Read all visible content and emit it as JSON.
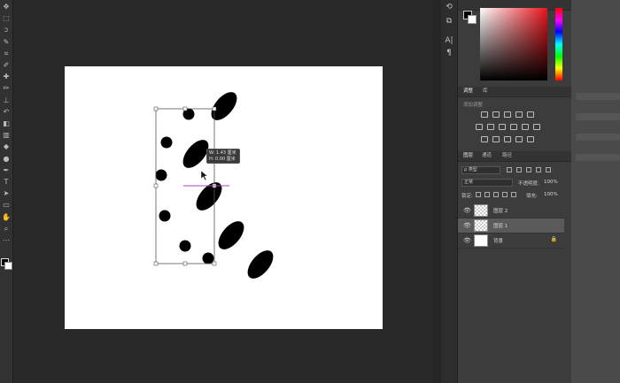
{
  "toolbar": {
    "tools": [
      {
        "name": "move-tool-icon",
        "glyph": "✥"
      },
      {
        "name": "marquee-tool-icon",
        "glyph": "⬚"
      },
      {
        "name": "lasso-tool-icon",
        "glyph": "ↄ"
      },
      {
        "name": "quick-select-tool-icon",
        "glyph": "✎"
      },
      {
        "name": "crop-tool-icon",
        "glyph": "⌗"
      },
      {
        "name": "eyedropper-tool-icon",
        "glyph": "✐"
      },
      {
        "name": "healing-brush-tool-icon",
        "glyph": "✚"
      },
      {
        "name": "brush-tool-icon",
        "glyph": "✏"
      },
      {
        "name": "clone-stamp-tool-icon",
        "glyph": "⊥"
      },
      {
        "name": "history-brush-tool-icon",
        "glyph": "↶"
      },
      {
        "name": "eraser-tool-icon",
        "glyph": "◧"
      },
      {
        "name": "gradient-tool-icon",
        "glyph": "▥"
      },
      {
        "name": "blur-tool-icon",
        "glyph": "◆"
      },
      {
        "name": "dodge-tool-icon",
        "glyph": "●"
      },
      {
        "name": "pen-tool-icon",
        "glyph": "✒"
      },
      {
        "name": "type-tool-icon",
        "glyph": "T"
      },
      {
        "name": "path-select-tool-icon",
        "glyph": "➤"
      },
      {
        "name": "shape-tool-icon",
        "glyph": "▭"
      },
      {
        "name": "hand-tool-icon",
        "glyph": "✋"
      },
      {
        "name": "zoom-tool-icon",
        "glyph": "⌕"
      },
      {
        "name": "more-tools-icon",
        "glyph": "⋯"
      }
    ]
  },
  "transform_tooltip": {
    "line1": "W: 1.43 厘米",
    "line2": "H: 0.00 厘米"
  },
  "panels": {
    "color_tabs": [],
    "adjustments_tabs": [
      "调整",
      "库"
    ],
    "adjustments_label": "添加调整",
    "layers_tabs": [
      "图层",
      "通道",
      "路径"
    ],
    "layers_filter": "ρ 类型",
    "blend_mode": "正常",
    "opacity_label": "不透明度:",
    "opacity_value": "100%",
    "lock_label": "锁定:",
    "fill_label": "填充:",
    "fill_value": "100%",
    "layers": [
      {
        "name": "图层 2",
        "thumb": "checker",
        "selected": false,
        "locked": false
      },
      {
        "name": "图层 1",
        "thumb": "checker",
        "selected": true,
        "locked": false
      },
      {
        "name": "背景",
        "thumb": "white",
        "selected": false,
        "locked": true
      }
    ]
  },
  "strip_icons": [
    {
      "name": "history-panel-icon",
      "glyph": "⟲"
    },
    {
      "name": "properties-panel-icon",
      "glyph": "⧉"
    },
    {
      "name": "character-panel-icon",
      "glyph": "A|"
    },
    {
      "name": "paragraph-panel-icon",
      "glyph": "¶"
    }
  ],
  "colors": {
    "accent_field": "#e8141c",
    "path_line": "#b23dbd"
  }
}
